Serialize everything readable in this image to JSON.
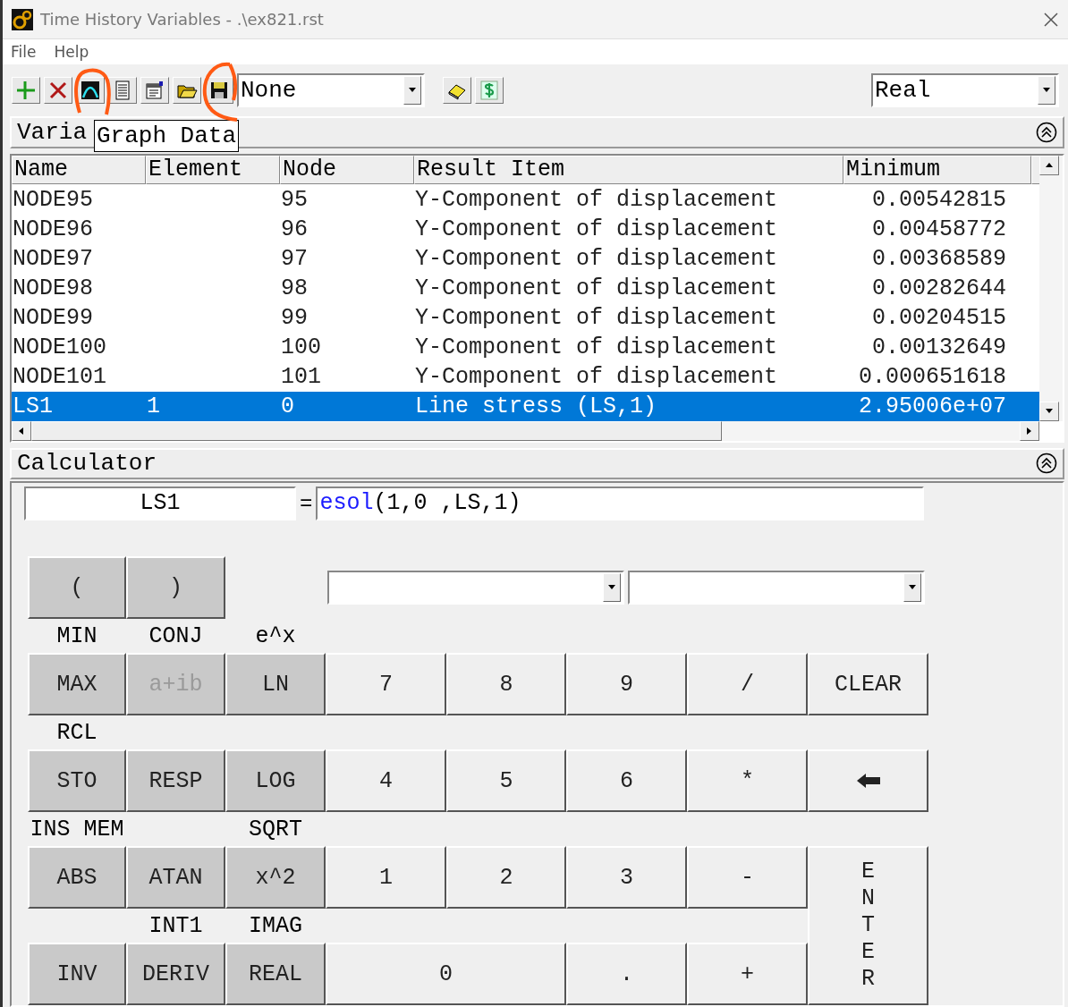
{
  "window": {
    "title": "Time History Variables - .\\ex821.rst"
  },
  "menu": [
    {
      "label": "File"
    },
    {
      "label": "Help"
    }
  ],
  "toolbar": {
    "combo": "None",
    "type_combo": "Real",
    "tooltip": "Graph Data"
  },
  "variables": {
    "title": "Varia",
    "columns": [
      "Name",
      "Element",
      "Node",
      "Result Item",
      "Minimum"
    ],
    "rows": [
      {
        "cells": [
          "NODE95",
          "",
          "95",
          "Y-Component of displacement",
          "0.00542815"
        ],
        "selected": false
      },
      {
        "cells": [
          "NODE96",
          "",
          "96",
          "Y-Component of displacement",
          "0.00458772"
        ],
        "selected": false
      },
      {
        "cells": [
          "NODE97",
          "",
          "97",
          "Y-Component of displacement",
          "0.00368589"
        ],
        "selected": false
      },
      {
        "cells": [
          "NODE98",
          "",
          "98",
          "Y-Component of displacement",
          "0.00282644"
        ],
        "selected": false
      },
      {
        "cells": [
          "NODE99",
          "",
          "99",
          "Y-Component of displacement",
          "0.00204515"
        ],
        "selected": false
      },
      {
        "cells": [
          "NODE100",
          "",
          "100",
          "Y-Component of displacement",
          "0.00132649"
        ],
        "selected": false
      },
      {
        "cells": [
          "NODE101",
          "",
          "101",
          "Y-Component of displacement",
          "0.000651618"
        ],
        "selected": false
      },
      {
        "cells": [
          "LS1",
          "1",
          "0",
          "Line stress (LS,1)",
          "2.95006e+07"
        ],
        "selected": true
      }
    ]
  },
  "calculator": {
    "title": "Calculator",
    "name": "LS1",
    "equals": "=",
    "function": "esol",
    "arguments": "(1,0 ,LS,1)",
    "labels": [
      "MIN",
      "CONJ",
      "e^x",
      "RCL",
      "INS MEM",
      "SQRT",
      "INT1",
      "IMAG"
    ],
    "keys": [
      {
        "label": "(",
        "kind": "function",
        "disabled": false
      },
      {
        "label": ")",
        "kind": "function",
        "disabled": false
      },
      {
        "label": "MAX",
        "kind": "function",
        "disabled": false
      },
      {
        "label": "a+ib",
        "kind": "function",
        "disabled": true
      },
      {
        "label": "LN",
        "kind": "function",
        "disabled": false
      },
      {
        "label": "7",
        "kind": "digit",
        "disabled": false
      },
      {
        "label": "8",
        "kind": "digit",
        "disabled": false
      },
      {
        "label": "9",
        "kind": "digit",
        "disabled": false
      },
      {
        "label": "/",
        "kind": "digit",
        "disabled": false
      },
      {
        "label": "CLEAR",
        "kind": "digit",
        "disabled": false
      },
      {
        "label": "STO",
        "kind": "function",
        "disabled": false
      },
      {
        "label": "RESP",
        "kind": "function",
        "disabled": false
      },
      {
        "label": "LOG",
        "kind": "function",
        "disabled": false
      },
      {
        "label": "4",
        "kind": "digit",
        "disabled": false
      },
      {
        "label": "5",
        "kind": "digit",
        "disabled": false
      },
      {
        "label": "6",
        "kind": "digit",
        "disabled": false
      },
      {
        "label": "*",
        "kind": "digit",
        "disabled": false
      },
      {
        "kind": "backspace",
        "disabled": false
      },
      {
        "label": "ABS",
        "kind": "function",
        "disabled": false
      },
      {
        "label": "ATAN",
        "kind": "function",
        "disabled": false
      },
      {
        "label": "x^2",
        "kind": "function",
        "disabled": false
      },
      {
        "label": "1",
        "kind": "digit",
        "disabled": false
      },
      {
        "label": "2",
        "kind": "digit",
        "disabled": false
      },
      {
        "label": "3",
        "kind": "digit",
        "disabled": false
      },
      {
        "label": "-",
        "kind": "digit",
        "disabled": false
      },
      {
        "label": "INV",
        "kind": "function",
        "disabled": false
      },
      {
        "label": "DERIV",
        "kind": "function",
        "disabled": false
      },
      {
        "label": "REAL",
        "kind": "function",
        "disabled": false
      },
      {
        "label": "0",
        "kind": "digit",
        "disabled": false
      },
      {
        "label": ".",
        "kind": "digit",
        "disabled": false
      },
      {
        "label": "+",
        "kind": "digit",
        "disabled": false
      },
      {
        "label": "ENTER",
        "kind": "enter",
        "disabled": false
      }
    ]
  }
}
